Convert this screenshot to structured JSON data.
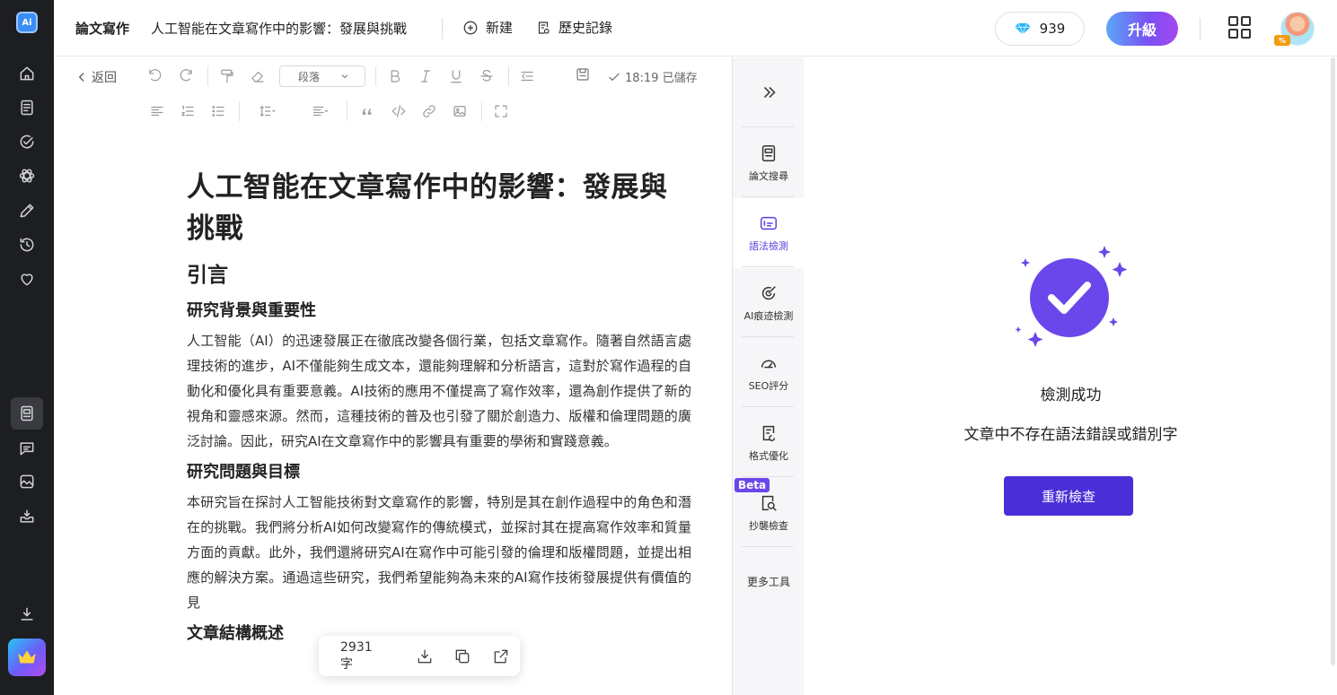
{
  "rail": {
    "logo_label": "Ai",
    "icons": [
      "home-icon",
      "document-icon",
      "check-circle-icon",
      "atom-icon",
      "pencil-icon",
      "history-icon",
      "heart-icon",
      "paper-icon",
      "chat-icon",
      "image-icon",
      "inbox-icon",
      "download-icon",
      "crown-icon"
    ]
  },
  "header": {
    "app_title": "論文寫作",
    "doc_title": "人工智能在文章寫作中的影響：發展與挑戰",
    "new_label": "新建",
    "history_label": "歷史記錄",
    "gems": "939",
    "upgrade_label": "升級",
    "avatar_badge": "%"
  },
  "toolbar": {
    "back_label": "返回",
    "paragraph_select": "段落",
    "saved_status": "18:19 已儲存"
  },
  "document": {
    "title": "人工智能在文章寫作中的影響：發展與挑戰",
    "h_intro": "引言",
    "h_background": "研究背景與重要性",
    "p_background": "人工智能（AI）的迅速發展正在徹底改變各個行業，包括文章寫作。隨著自然語言處理技術的進步，AI不僅能夠生成文本，還能夠理解和分析語言，這對於寫作過程的自動化和優化具有重要意義。AI技術的應用不僅提高了寫作效率，還為創作提供了新的視角和靈感來源。然而，這種技術的普及也引發了關於創造力、版權和倫理問題的廣泛討論。因此，研究AI在文章寫作中的影響具有重要的學術和實踐意義。",
    "h_questions": "研究問題與目標",
    "p_questions": "本研究旨在探討人工智能技術對文章寫作的影響，特別是其在創作過程中的角色和潛在的挑戰。我們將分析AI如何改變寫作的傳統模式，並探討其在提高寫作效率和質量方面的貢獻。此外，我們還將研究AI在寫作中可能引發的倫理和版權問題，並提出相應的解決方案。通過這些研究，我們希望能夠為未來的AI寫作技術發展提供有價值的見",
    "h_structure": "文章結構概述"
  },
  "float_bar": {
    "word_count": "2931 字"
  },
  "tools": {
    "items": [
      {
        "label": "論文搜尋"
      },
      {
        "label": "語法檢測"
      },
      {
        "label": "AI痕迹檢測"
      },
      {
        "label": "SEO評分"
      },
      {
        "label": "格式優化"
      },
      {
        "label": "抄襲檢查"
      }
    ],
    "beta_label": "Beta",
    "more_label": "更多工具"
  },
  "panel": {
    "success_title": "檢測成功",
    "success_message": "文章中不存在語法錯誤或錯別字",
    "recheck_label": "重新檢查"
  },
  "colors": {
    "accent": "#4a2fd8",
    "success_circle": "#6a47ea",
    "rail_bg": "#1d1e22"
  }
}
